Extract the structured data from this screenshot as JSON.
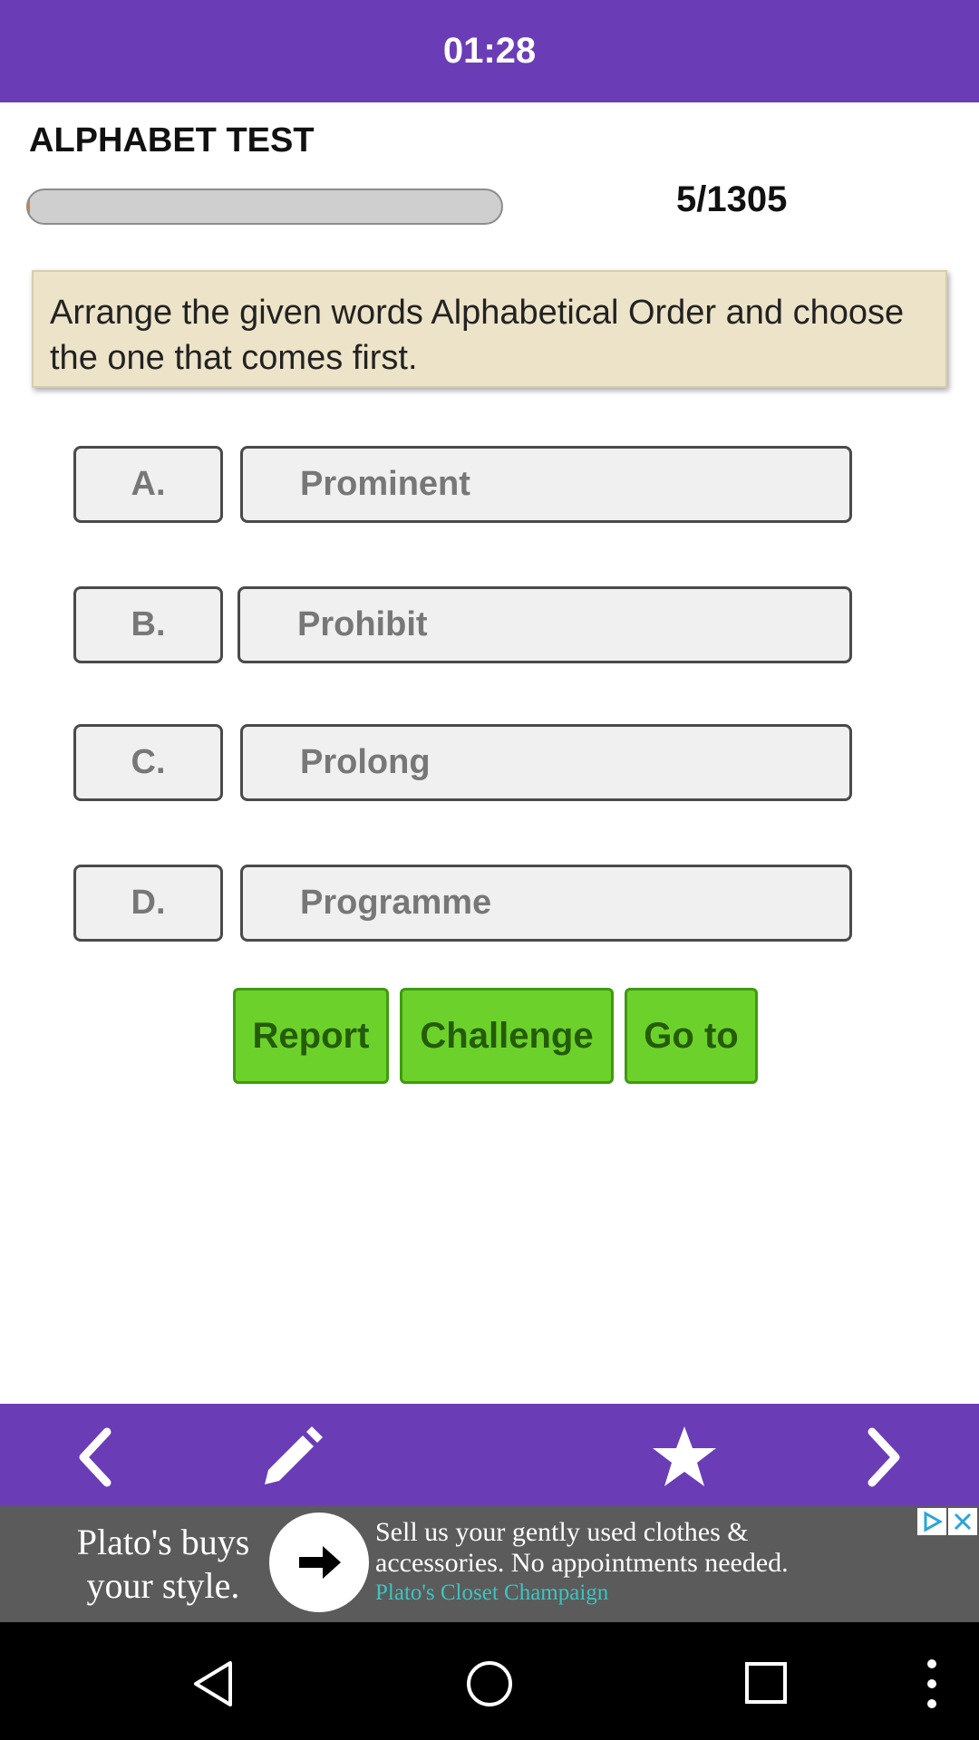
{
  "colors": {
    "brand": "#6a3db7",
    "option_bg": "#f0f0f0",
    "action_green": "#6dd12b",
    "question_bg": "#ece3c8"
  },
  "header": {
    "timer": "01:28"
  },
  "test": {
    "title": "ALPHABET TEST",
    "progress_fraction": 0.004,
    "counter": "5/1305"
  },
  "question": {
    "text": "Arrange the given words Alphabetical Order and choose the one that comes first."
  },
  "options": [
    {
      "letter": "A.",
      "text": "Prominent"
    },
    {
      "letter": "B.",
      "text": "Prohibit"
    },
    {
      "letter": "C.",
      "text": "Prolong"
    },
    {
      "letter": "D.",
      "text": "Programme"
    }
  ],
  "actions": {
    "report": "Report",
    "challenge": "Challenge",
    "goto": "Go to"
  },
  "bottom_nav": {
    "icons": [
      "chevron-left-icon",
      "pencil-icon",
      "star-icon",
      "chevron-right-icon"
    ]
  },
  "ad": {
    "left_line1": "Plato's buys",
    "left_line2": "your style.",
    "line1": "Sell us your gently used clothes &",
    "line2": "accessories. No appointments needed.",
    "sponsor": "Plato's Closet Champaign"
  },
  "system_nav": {
    "icons": [
      "back-icon",
      "home-icon",
      "recents-icon",
      "more-icon"
    ]
  }
}
